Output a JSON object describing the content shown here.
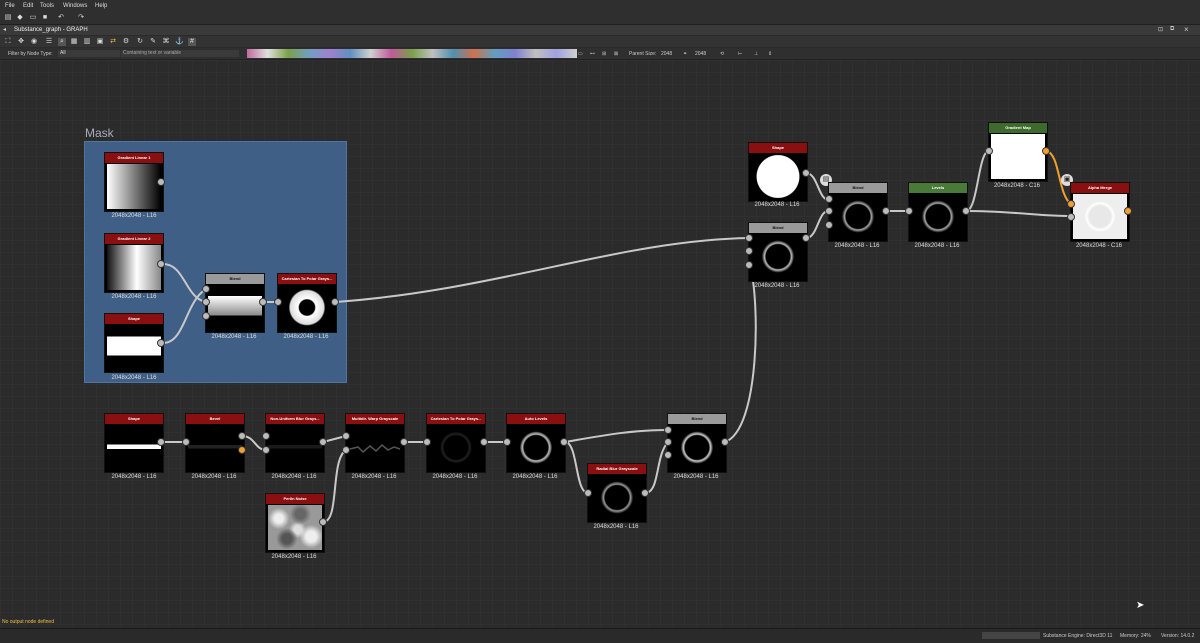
{
  "menu": {
    "items": [
      "File",
      "Edit",
      "Tools",
      "Windows",
      "Help"
    ]
  },
  "graph_tab": {
    "title": "Substance_graph - GRAPH"
  },
  "filters": {
    "by_node_type_label": "Filter by Node Type:",
    "by_node_type_value": "All",
    "text_placeholder": "Containing text or variable"
  },
  "parent_size": {
    "label": "Parent Size:",
    "value": "2048",
    "value2": "2048"
  },
  "frame": {
    "title": "Mask"
  },
  "nodes": {
    "grad1": {
      "title": "Gradient Linear 1",
      "res": "2048x2048 - L16",
      "color": "#8a0f10"
    },
    "grad2": {
      "title": "Gradient Linear 2",
      "res": "2048x2048 - L16",
      "color": "#8a0f10"
    },
    "shape_mask": {
      "title": "Shape",
      "res": "2048x2048 - L16",
      "color": "#8a0f10"
    },
    "blend_mask": {
      "title": "Blend",
      "res": "2048x2048 - L16",
      "color": "#9a9a9a"
    },
    "cart_mask": {
      "title": "Cartesian To Polar Grays...",
      "res": "2048x2048 - L16",
      "color": "#8a0f10"
    },
    "shape2": {
      "title": "Shape",
      "res": "2048x2048 - L16",
      "color": "#8a0f10"
    },
    "bevel": {
      "title": "Bevel",
      "res": "2048x2048 - L16",
      "color": "#8a0f10"
    },
    "nublur": {
      "title": "Non-Uniform Blur Grays...",
      "res": "2048x2048 - L16",
      "color": "#8a0f10"
    },
    "warp": {
      "title": "Multidir. Warp Grayscale",
      "res": "2048x2048 - L16",
      "color": "#8a0f10"
    },
    "cart2": {
      "title": "Cartesian To Polar Grays...",
      "res": "2048x2048 - L16",
      "color": "#8a0f10"
    },
    "autolev": {
      "title": "Auto Levels",
      "res": "2048x2048 - L16",
      "color": "#8a0f10"
    },
    "radblur": {
      "title": "Radial Blur Grayscale",
      "res": "2048x2048 - L16",
      "color": "#8a0f10"
    },
    "blend_low": {
      "title": "Blend",
      "res": "2048x2048 - L16",
      "color": "#9a9a9a"
    },
    "perlin": {
      "title": "Perlin Noise",
      "res": "2048x2048 - L16",
      "color": "#8a0f10"
    },
    "shape_top": {
      "title": "Shape",
      "res": "2048x2048 - L16",
      "color": "#8a0f10"
    },
    "blend_mid": {
      "title": "Blend",
      "res": "2048x2048 - L16",
      "color": "#9a9a9a"
    },
    "blend_top": {
      "title": "Blend",
      "res": "2048x2048 - L16",
      "color": "#9a9a9a"
    },
    "levels": {
      "title": "Levels",
      "res": "2048x2048 - L16",
      "color": "#4a7a3a"
    },
    "gradmap": {
      "title": "Gradient Map",
      "res": "2048x2048 - C16",
      "color": "#3f6a2d"
    },
    "alpha": {
      "title": "Alpha Merge",
      "res": "2048x2048 - C16",
      "color": "#8a0f10"
    }
  },
  "status": {
    "left": "No output node defined",
    "engine": "Substance Engine: Direct3D 11",
    "memory": "Memory: 24%",
    "version": "Version: 14.0.2"
  }
}
